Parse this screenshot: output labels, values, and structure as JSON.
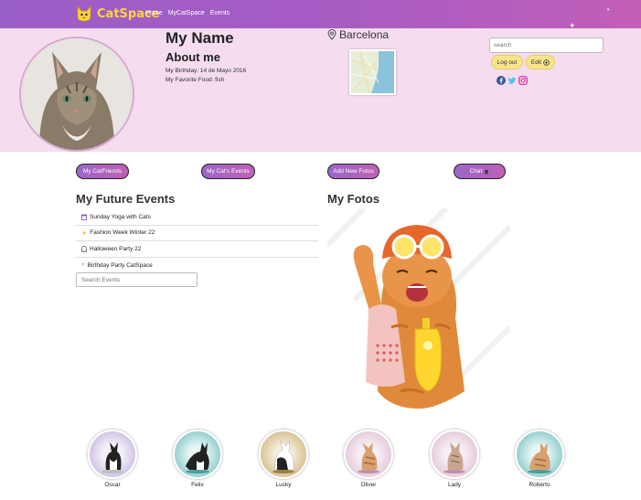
{
  "brand": {
    "name": "CatSpace"
  },
  "nav": {
    "items": [
      "Home",
      "MyCatSpace",
      "Events"
    ]
  },
  "profile": {
    "name": "My Name",
    "about_title": "About me",
    "birthday": "My Birthday: 14 de Mayo 2016",
    "food": "My Favorite Food: fish",
    "location": "Barcelona"
  },
  "header_search": {
    "placeholder": "search"
  },
  "buttons": {
    "logout": "Log out",
    "edit": "Edit"
  },
  "social": [
    "facebook-icon",
    "twitter-icon",
    "instagram-icon"
  ],
  "pills": [
    "My CatFriends",
    "My Cat's Events",
    "Add New Fotos",
    "Chat"
  ],
  "events_section": {
    "title": "My Future Events",
    "items": [
      {
        "label": "Sunday Yoga with Cats",
        "icon": "calendar-icon"
      },
      {
        "label": "Fashion Week Winter 22",
        "icon": "star-icon"
      },
      {
        "label": "Halloween Party 22",
        "icon": "ghost-icon"
      },
      {
        "label": "Birthday Party CatSpace",
        "icon": "heart-icon"
      }
    ],
    "search_placeholder": "Search Events"
  },
  "fotos_section": {
    "title": "My Fotos"
  },
  "friends": [
    "Oscar",
    "Felix",
    "Lucky",
    "Oliver",
    "Lady",
    "Roberto"
  ],
  "colors": {
    "topbar": "#a85cc3",
    "band": "#f5dcef",
    "brand_yellow": "#ffd43b",
    "button_yellow": "#f8e58a"
  }
}
